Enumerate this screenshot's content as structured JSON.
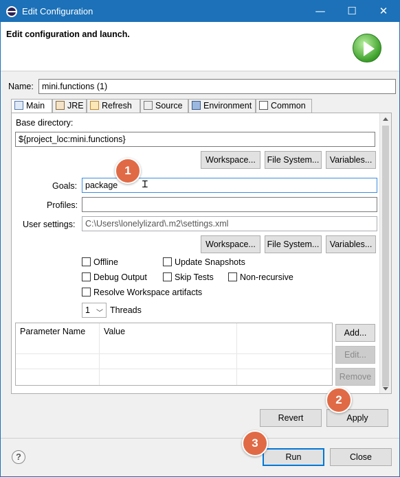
{
  "window": {
    "title": "Edit Configuration",
    "controls": [
      "—",
      "☐",
      "✕"
    ]
  },
  "header": {
    "text": "Edit configuration and launch."
  },
  "name_field": {
    "label": "Name:",
    "value": "mini.functions (1)"
  },
  "tabs": [
    {
      "label": "Main",
      "active": true
    },
    {
      "label": "JRE",
      "active": false
    },
    {
      "label": "Refresh",
      "active": false
    },
    {
      "label": "Source",
      "active": false
    },
    {
      "label": "Environment",
      "active": false
    },
    {
      "label": "Common",
      "active": false
    }
  ],
  "main": {
    "base_directory_label": "Base directory:",
    "base_directory_value": "${project_loc:mini.functions}",
    "buttons_row1": {
      "workspace": "Workspace...",
      "file_system": "File System...",
      "variables": "Variables..."
    },
    "goals_label": "Goals:",
    "goals_value": "package",
    "profiles_label": "Profiles:",
    "profiles_value": "",
    "user_settings_label": "User settings:",
    "user_settings_value": "C:\\Users\\lonelylizard\\.m2\\settings.xml",
    "buttons_row2": {
      "workspace": "Workspace...",
      "file_system": "File System...",
      "variables": "Variables..."
    },
    "checkboxes": {
      "offline": "Offline",
      "update_snapshots": "Update Snapshots",
      "debug_output": "Debug Output",
      "skip_tests": "Skip Tests",
      "non_recursive": "Non-recursive",
      "resolve_workspace": "Resolve Workspace artifacts"
    },
    "threads_value": "1",
    "threads_label": "Threads",
    "table": {
      "columns": [
        "Parameter Name",
        "Value"
      ]
    },
    "table_buttons": {
      "add": "Add...",
      "edit": "Edit...",
      "remove": "Remove"
    }
  },
  "footer": {
    "revert": "Revert",
    "apply": "Apply",
    "run": "Run",
    "close": "Close",
    "help": "?"
  },
  "callouts": [
    "1",
    "2",
    "3"
  ],
  "colors": {
    "titlebar": "#1c71b8",
    "callout": "#e06a45",
    "focus_border": "#3c8dde"
  }
}
